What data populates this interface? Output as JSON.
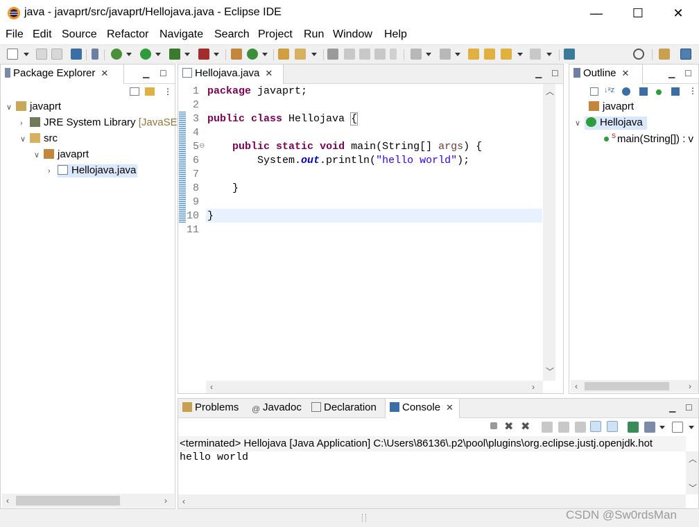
{
  "window": {
    "title": "java - javaprt/src/javaprt/Hellojava.java - Eclipse IDE",
    "min_glyph": "—",
    "max_glyph": "☐",
    "close_glyph": "✕"
  },
  "menu": [
    "File",
    "Edit",
    "Source",
    "Refactor",
    "Navigate",
    "Search",
    "Project",
    "Run",
    "Window",
    "Help"
  ],
  "package_explorer": {
    "tab_label": "Package Explorer",
    "tree": [
      {
        "label": "javaprt",
        "icon": "project-folder-icon",
        "expanded": true
      },
      {
        "label": "JRE System Library",
        "suffix": "[JavaSE",
        "icon": "library-icon",
        "expanded": false
      },
      {
        "label": "src",
        "icon": "source-folder-icon",
        "expanded": true
      },
      {
        "label": "javaprt",
        "icon": "package-icon",
        "expanded": true
      },
      {
        "label": "Hellojava.java",
        "icon": "java-file-icon",
        "expanded": false,
        "selected": true
      }
    ]
  },
  "editor": {
    "tab_label": "Hellojava.java",
    "line_numbers": [
      "1",
      "2",
      "3",
      "4",
      "5",
      "6",
      "7",
      "8",
      "9",
      "10",
      "11"
    ],
    "code": {
      "l1_kw": "package",
      "l1_rest": " javaprt;",
      "l3_kw1": "public",
      "l3_kw2": "class",
      "l3_name": " Hellojava ",
      "l3_brace": "{",
      "l5_indent": "    ",
      "l5_kw1": "public",
      "l5_kw2": "static",
      "l5_kw3": "void",
      "l5_mid": " main(String[] ",
      "l5_arg": "args",
      "l5_end": ") {",
      "l6_a": "        System.",
      "l6_field": "out",
      "l6_b": ".println(",
      "l6_str": "\"hello world\"",
      "l6_c": ");",
      "l8": "    }",
      "l10": "}"
    }
  },
  "outline": {
    "tab_label": "Outline",
    "items": [
      {
        "label": "javaprt",
        "icon": "package-icon"
      },
      {
        "label": "Hellojava",
        "icon": "class-icon",
        "selected": true
      },
      {
        "label": "main(String[]) : v",
        "icon": "public-static-method-icon"
      }
    ]
  },
  "bottom": {
    "tabs": [
      "Problems",
      "Javadoc",
      "Declaration",
      "Console"
    ],
    "console_header": "<terminated> Hellojava [Java Application] C:\\Users\\86136\\.p2\\pool\\plugins\\org.eclipse.justj.openjdk.hot",
    "console_output": "hello world"
  },
  "watermark": "CSDN @Sw0rdsMan",
  "colors": {
    "keyword": "#7f0055",
    "string": "#2a00ff",
    "field": "#0000c0",
    "selection": "#d9e8fb"
  }
}
